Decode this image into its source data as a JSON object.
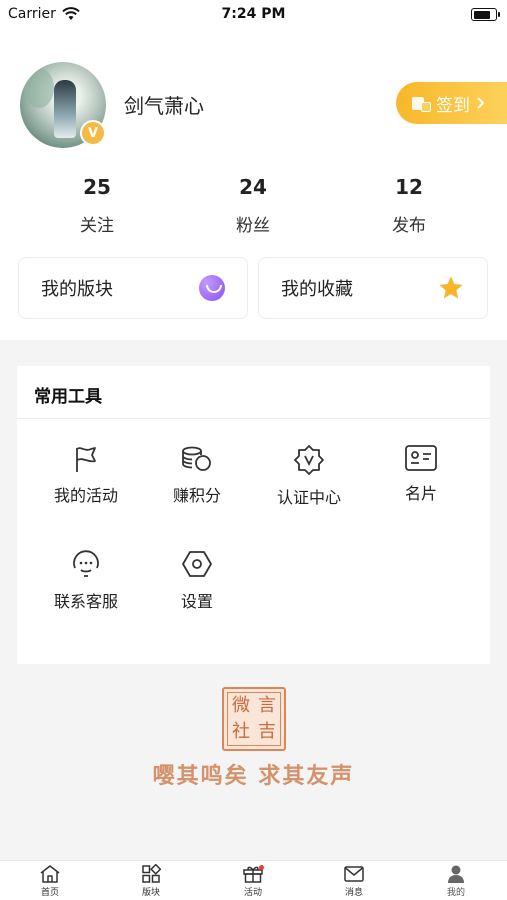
{
  "status_bar": {
    "carrier": "Carrier",
    "time": "7:24 PM",
    "battery_level": 0.8
  },
  "profile": {
    "username": "剑气萧心",
    "verified_badge": "V",
    "checkin_label": "签到",
    "stats": [
      {
        "value": "25",
        "label": "关注"
      },
      {
        "value": "24",
        "label": "粉丝"
      },
      {
        "value": "12",
        "label": "发布"
      }
    ],
    "cards": [
      {
        "label": "我的版块",
        "icon": "chat-bubble-icon"
      },
      {
        "label": "我的收藏",
        "icon": "star-icon"
      }
    ]
  },
  "tools": {
    "title": "常用工具",
    "items": [
      {
        "label": "我的活动",
        "icon": "flag-icon"
      },
      {
        "label": "赚积分",
        "icon": "coins-icon"
      },
      {
        "label": "认证中心",
        "icon": "badge-icon"
      },
      {
        "label": "名片",
        "icon": "id-card-icon"
      },
      {
        "label": "联系客服",
        "icon": "headset-icon"
      },
      {
        "label": "设置",
        "icon": "gear-icon"
      }
    ]
  },
  "footer": {
    "seal_chars": [
      "微",
      "言",
      "社",
      "吉"
    ],
    "motto": "嘤其鸣矣 求其友声"
  },
  "tabbar": {
    "items": [
      {
        "label": "首页",
        "icon": "home-icon"
      },
      {
        "label": "版块",
        "icon": "grid-icon"
      },
      {
        "label": "活动",
        "icon": "gift-icon"
      },
      {
        "label": "消息",
        "icon": "mail-icon"
      },
      {
        "label": "我的",
        "icon": "user-icon"
      }
    ],
    "active": "我的"
  },
  "colors": {
    "accent": "#f8b72a",
    "purple": "#8a4ef0",
    "star": "#f5b72a",
    "motto": "#d4926c"
  }
}
